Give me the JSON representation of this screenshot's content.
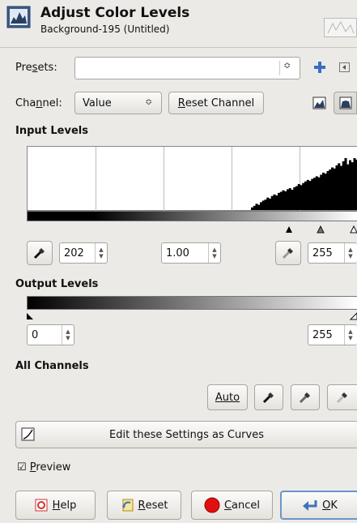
{
  "header": {
    "title": "Adjust Color Levels",
    "subtitle": "Background-195 (Untitled)"
  },
  "presets": {
    "label_pre": "Pre",
    "label_key": "s",
    "label_post": "ets:",
    "value": ""
  },
  "channel": {
    "label_pre": "Cha",
    "label_key": "n",
    "label_post": "nel:",
    "value": "Value",
    "reset_key": "R",
    "reset_rest": "eset Channel"
  },
  "input_levels": {
    "title": "Input Levels",
    "low": "202",
    "gamma": "1.00",
    "high": "255",
    "histogram": [
      0.05,
      0.08,
      0.12,
      0.1,
      0.15,
      0.18,
      0.2,
      0.24,
      0.22,
      0.27,
      0.3,
      0.28,
      0.33,
      0.35,
      0.38,
      0.36,
      0.4,
      0.42,
      0.39,
      0.44,
      0.46,
      0.5,
      0.48,
      0.52,
      0.55,
      0.58,
      0.56,
      0.6,
      0.62,
      0.65,
      0.63,
      0.68,
      0.72,
      0.7,
      0.75,
      0.78,
      0.82,
      0.8,
      0.86,
      0.9,
      0.85,
      0.94,
      1.0,
      0.88,
      0.96,
      0.92,
      1.0,
      0.97
    ]
  },
  "output_levels": {
    "title": "Output Levels",
    "low": "0",
    "high": "255"
  },
  "all_channels": {
    "title": "All Channels",
    "auto_label": "Auto"
  },
  "curves_button": {
    "label": "Edit these Settings as Curves"
  },
  "preview": {
    "key": "P",
    "rest": "review",
    "checked": true
  },
  "footer": {
    "help_key": "H",
    "help_rest": "elp",
    "reset_key": "R",
    "reset_rest": "eset",
    "cancel_key": "C",
    "cancel_rest": "ancel",
    "ok_key": "O",
    "ok_rest": "K"
  },
  "colors": {
    "ok_border": "#6b95c9",
    "bar_dark": "#000000",
    "bar_light": "#ffffff",
    "cancel_red": "#e01010"
  }
}
